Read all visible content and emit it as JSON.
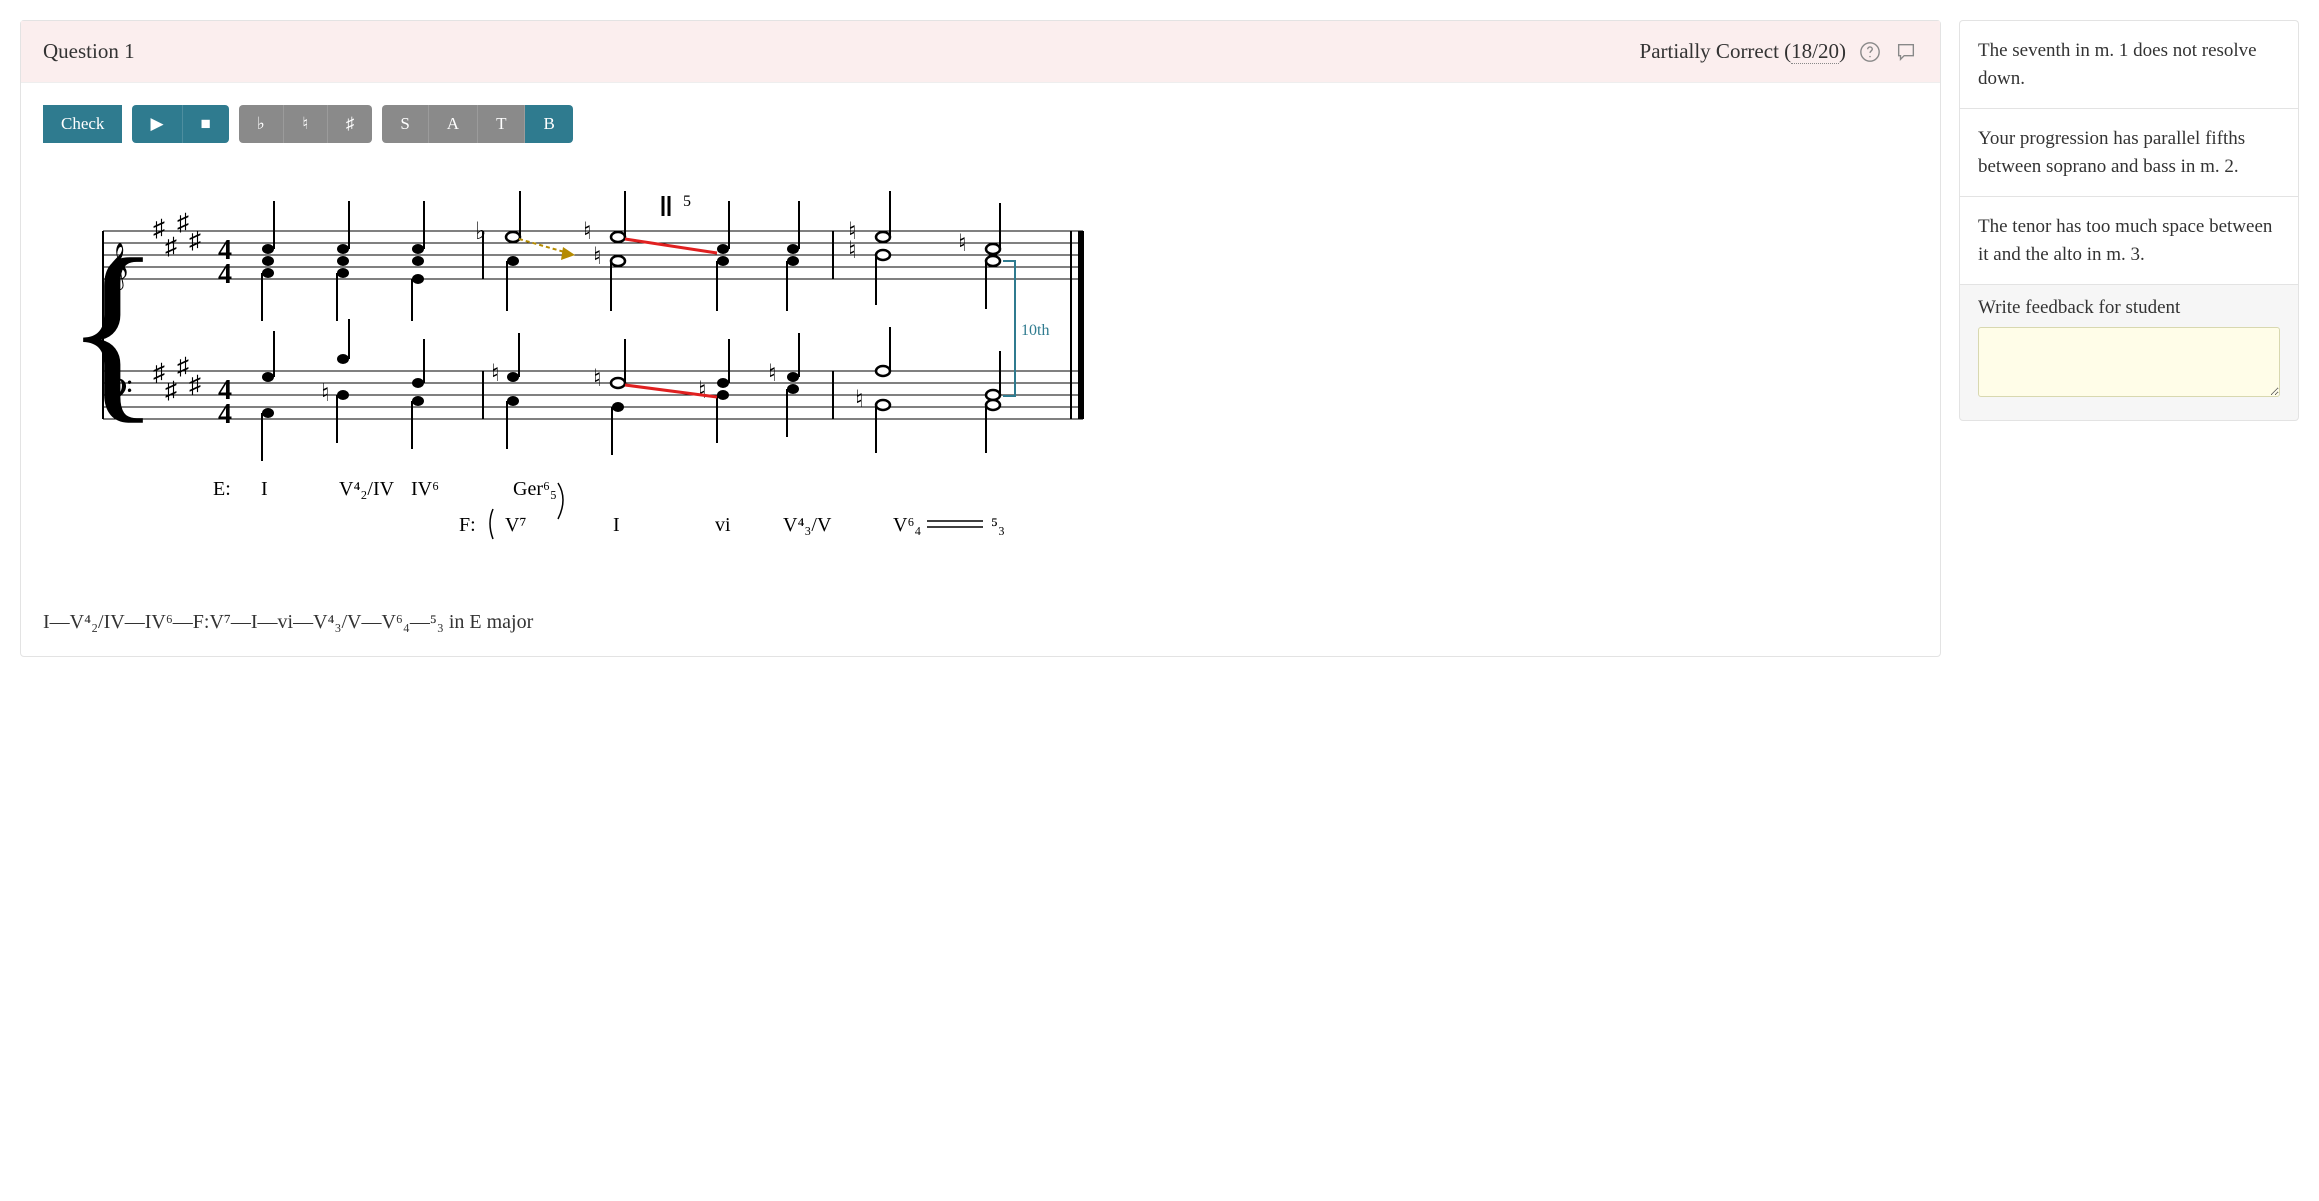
{
  "header": {
    "title": "Question 1",
    "result_label": "Partially Correct",
    "score": "18/20"
  },
  "toolbar": {
    "check": "Check",
    "play": "▶",
    "stop": "■",
    "flat": "♭",
    "natural": "♮",
    "sharp": "♯",
    "voice_s": "S",
    "voice_a": "A",
    "voice_t": "T",
    "voice_b": "B"
  },
  "score": {
    "measure_5_label": "5",
    "interval_label": "10th",
    "roman_row_1_key": "E:",
    "roman_row_2_key": "F:",
    "romans_row1": [
      "I",
      "V⁴₂/IV",
      "IV⁶",
      "Ger⁶₅"
    ],
    "romans_row2": [
      "V⁷",
      "I",
      "vi",
      "V⁴₃/V",
      "V⁶₄",
      "⁵₃"
    ]
  },
  "progression_text": "I—V⁴₂/IV—IV⁶—F:V⁷—I—vi—V⁴₃/V—V⁶₄—⁵₃ in E major",
  "feedback": {
    "items": [
      "The seventh in m. 1 does not resolve down.",
      "Your progression has parallel fifths between soprano and bass in m. 2.",
      "The tenor has too much space between it and the alto in m. 3."
    ],
    "input_label": "Write feedback for student",
    "placeholder": ""
  }
}
